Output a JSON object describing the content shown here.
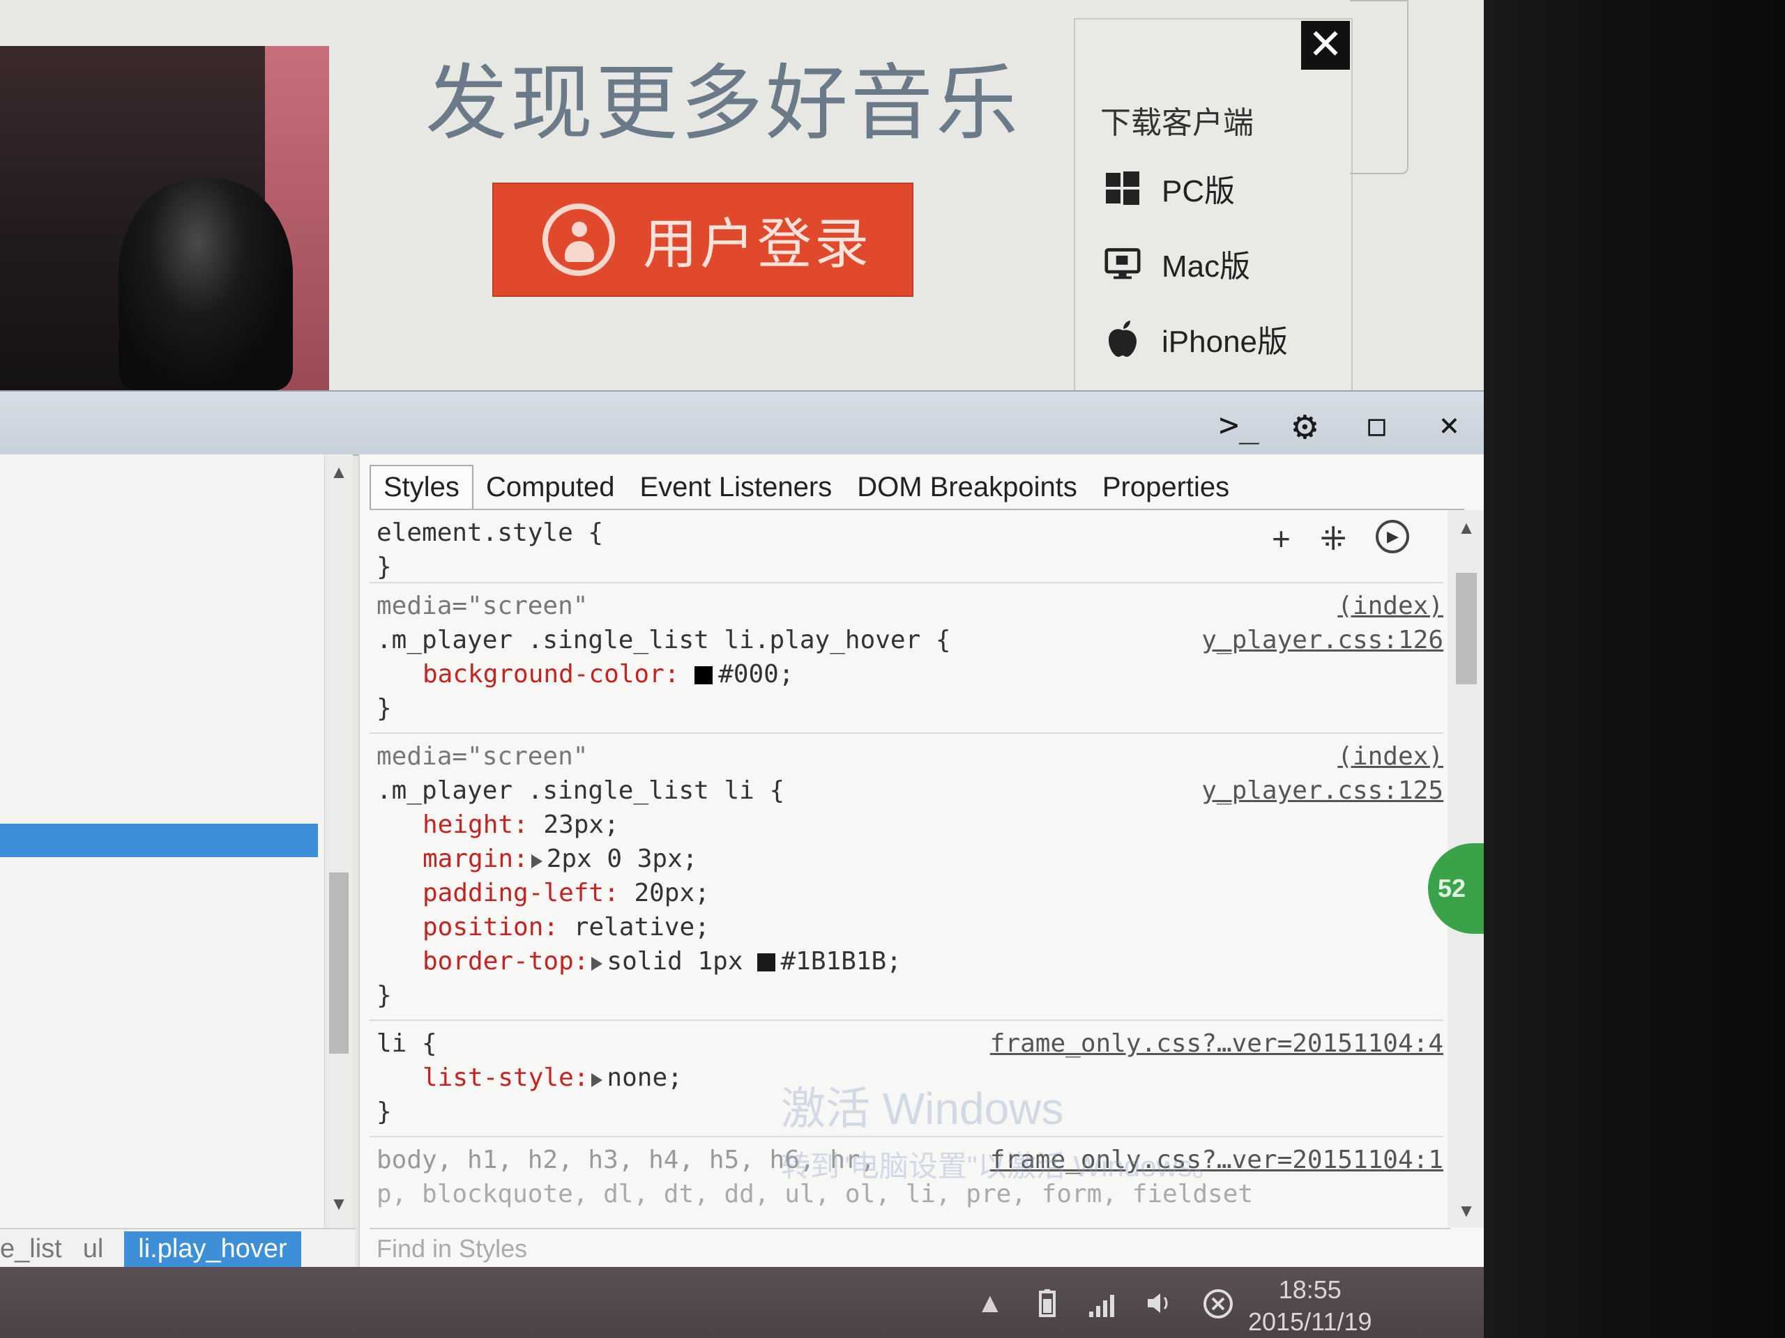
{
  "webpage": {
    "headline": "发现更多好音乐",
    "login_button": "用户登录",
    "download": {
      "title": "下载客户端",
      "items": [
        {
          "label": "PC版",
          "icon": "windows-icon"
        },
        {
          "label": "Mac版",
          "icon": "monitor-icon"
        },
        {
          "label": "iPhone版",
          "icon": "apple-icon"
        }
      ]
    },
    "close_glyph": "✕"
  },
  "devtools": {
    "toolbar": {
      "console_glyph": ">_",
      "settings_glyph": "⚙",
      "dock_glyph": "◻",
      "close_glyph": "×"
    },
    "tabs": [
      "Styles",
      "Computed",
      "Event Listeners",
      "DOM Breakpoints",
      "Properties"
    ],
    "active_tab": "Styles",
    "rule_tools": {
      "add": "+",
      "toggle": "⁜",
      "animate": "▶"
    },
    "rules": {
      "r0": {
        "selector_open": "element.style {",
        "close": "}"
      },
      "r1": {
        "media": "media=\"screen\"",
        "src1": "(index)",
        "selector": ".m_player .single_list li.play_hover {",
        "src2": "y_player.css:126",
        "props": [
          {
            "name": "background-color:",
            "value": "#000;"
          }
        ],
        "close": "}"
      },
      "r2": {
        "media": "media=\"screen\"",
        "src1": "(index)",
        "selector": ".m_player .single_list li {",
        "src2": "y_player.css:125",
        "p0": {
          "name": "height:",
          "value": "23px;"
        },
        "p1": {
          "name": "margin:",
          "value": "2px 0 3px;"
        },
        "p2": {
          "name": "padding-left:",
          "value": "20px;"
        },
        "p3": {
          "name": "position:",
          "value": "relative;"
        },
        "p4": {
          "name": "border-top:",
          "value_a": "solid 1px",
          "value_b": "#1B1B1B;"
        },
        "close": "}"
      },
      "r3": {
        "selector": "li {",
        "src": "frame_only.css?…ver=20151104:4",
        "p0": {
          "name": "list-style:",
          "value": "none;"
        },
        "close": "}"
      },
      "r4": {
        "selector": "body, h1, h2, h3, h4, h5, h6, hr,",
        "src": "frame_only.css?…ver=20151104:1",
        "selector2": "p, blockquote, dl, dt, dd, ul, ol, li, pre, form, fieldset"
      }
    },
    "find_placeholder": "Find in Styles",
    "breadcrumb": [
      "e_list",
      "ul",
      "li.play_hover"
    ],
    "badge": "52",
    "watermark": {
      "title": "激活 Windows",
      "sub": "转到\"电脑设置\"以激活 Windows。"
    }
  },
  "taskbar": {
    "time": "18:55",
    "date": "2015/11/19",
    "tray_icons": [
      "up-arrow-icon",
      "battery-icon",
      "signal-icon",
      "volume-icon",
      "network-icon"
    ]
  },
  "colors": {
    "accent_blue": "#3d8fd8",
    "login_red": "#e0492b",
    "css_prop": "#c4231f"
  }
}
